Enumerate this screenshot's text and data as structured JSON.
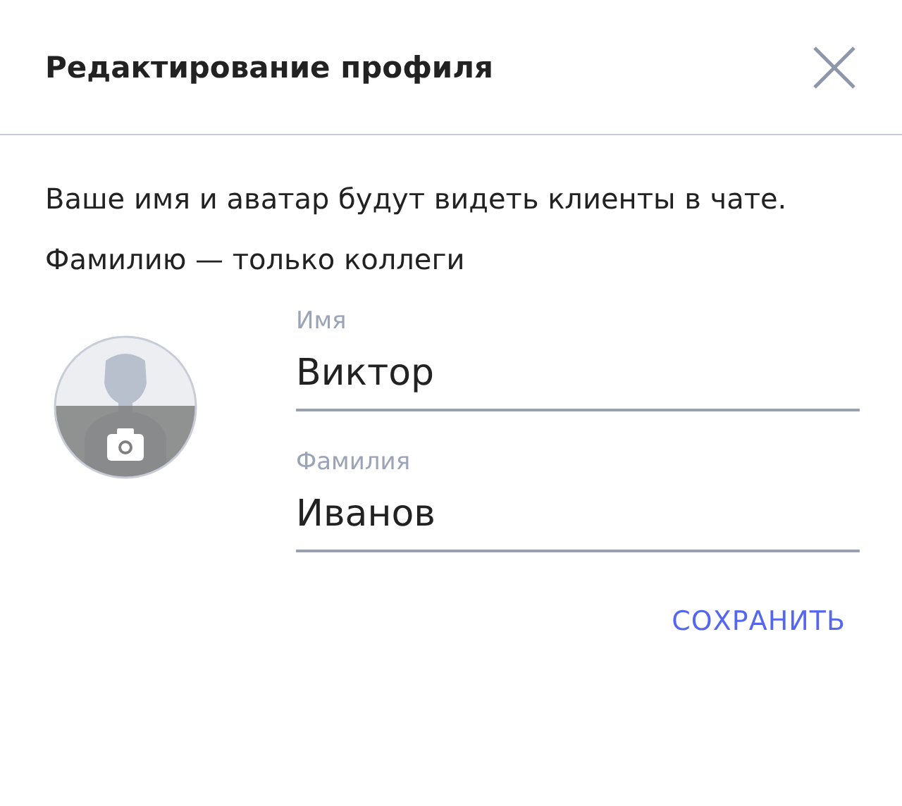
{
  "dialog": {
    "title": "Редактирование профиля"
  },
  "description": "Ваше имя и аватар будут видеть клиенты в чате. Фамилию — только коллеги",
  "fields": [
    {
      "label": "Имя",
      "value": "Виктор"
    },
    {
      "label": "Фамилия",
      "value": "Иванов"
    }
  ],
  "buttons": [
    {
      "label": "СОХРАНИТЬ"
    }
  ]
}
